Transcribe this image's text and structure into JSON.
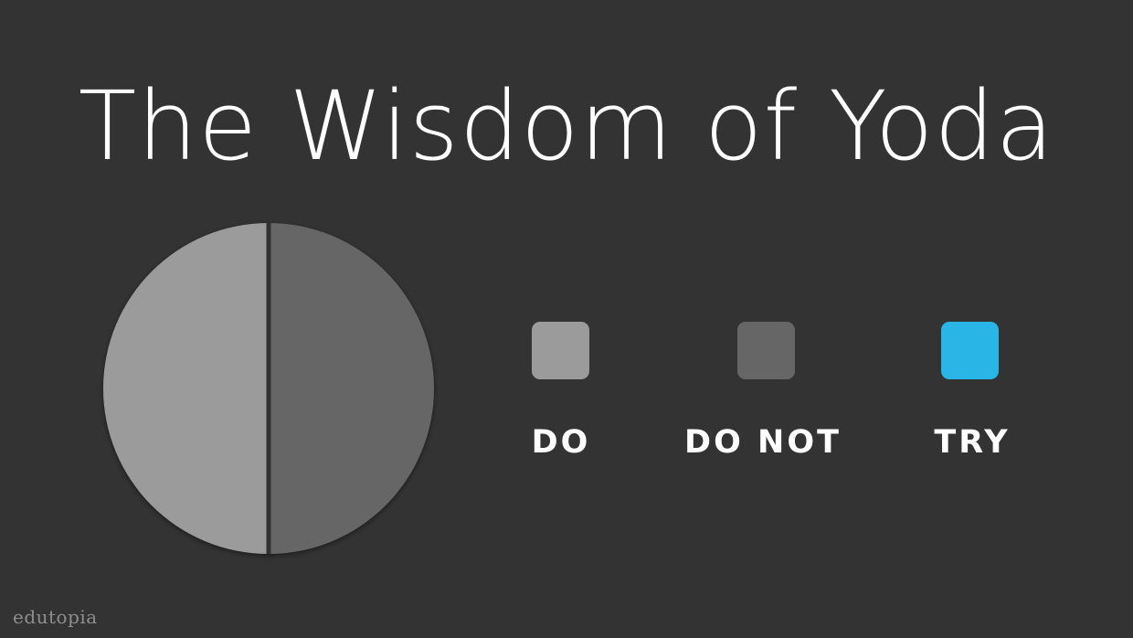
{
  "title": "The Wisdom of Yoda",
  "brand": "edutopia",
  "chart_data": {
    "type": "pie",
    "title": "The Wisdom of Yoda",
    "slices": [
      {
        "label": "DO",
        "value": 50,
        "color": "#9b9b9b"
      },
      {
        "label": "DO NOT",
        "value": 50,
        "color": "#666666"
      },
      {
        "label": "TRY",
        "value": 0,
        "color": "#29b6e6"
      }
    ],
    "legend_position": "right"
  }
}
